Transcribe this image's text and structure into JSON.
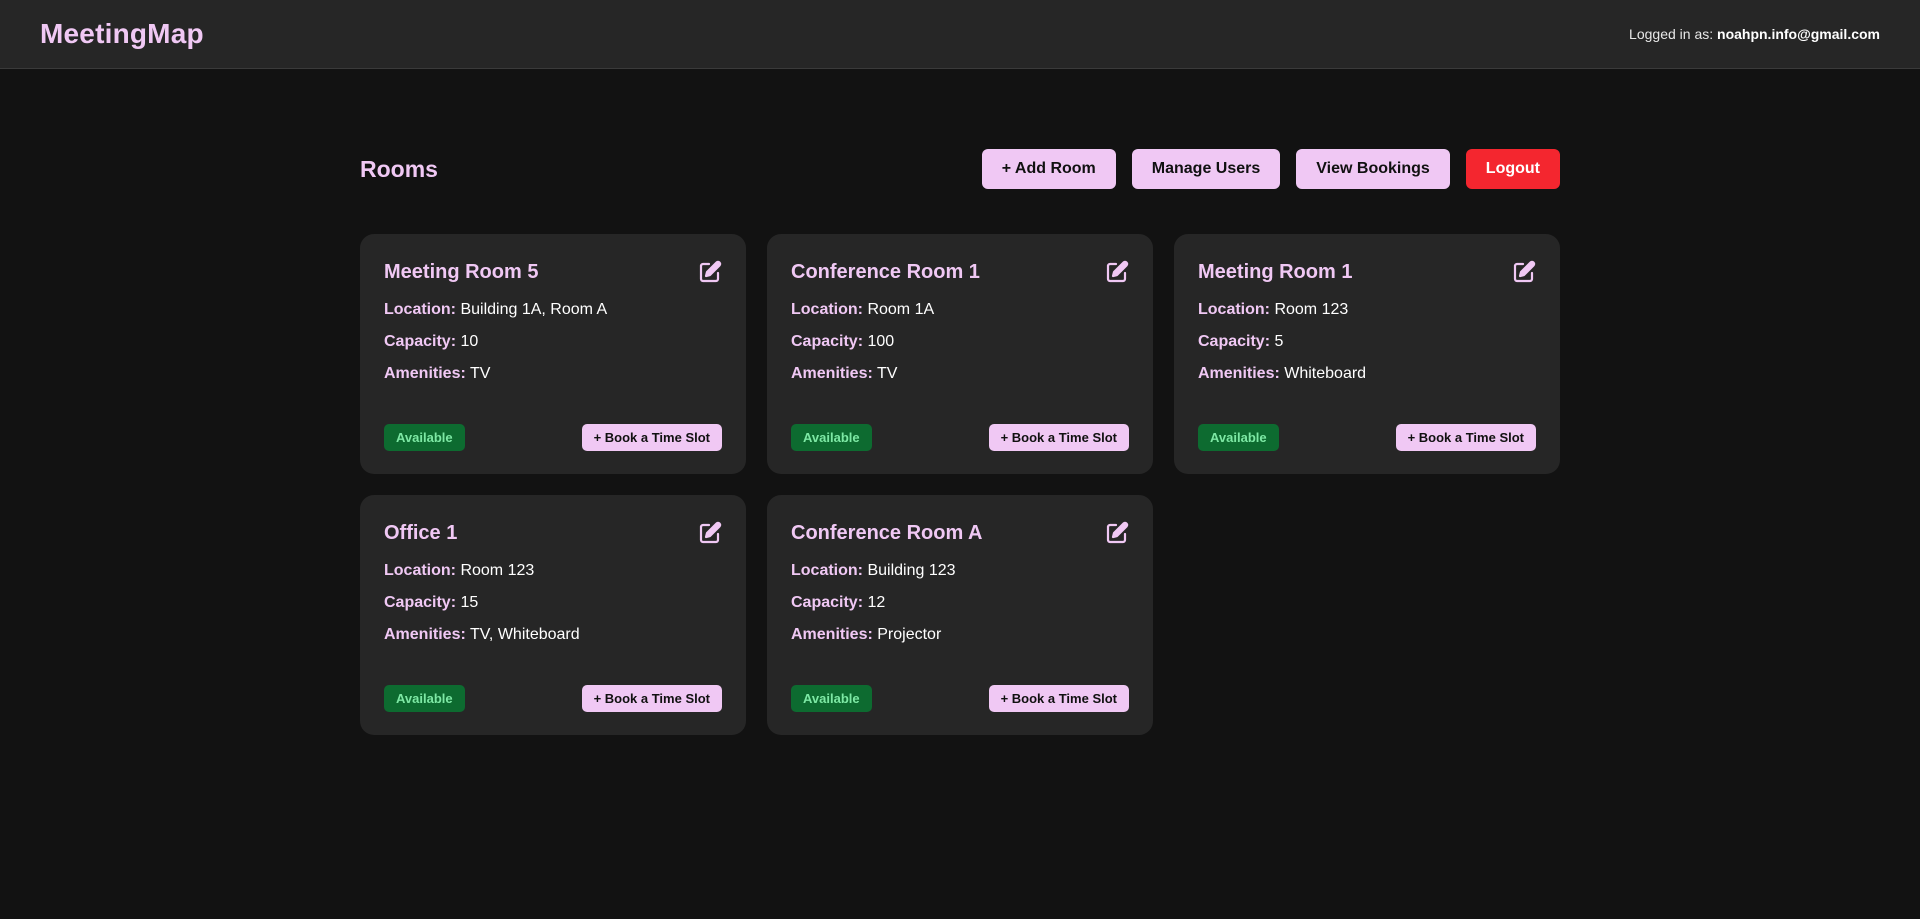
{
  "app": {
    "brand": "MeetingMap",
    "logged_in_label": "Logged in as:",
    "user_email": "noahpn.info@gmail.com"
  },
  "page": {
    "title": "Rooms",
    "actions": {
      "add_room": "+ Add Room",
      "manage_users": "Manage Users",
      "view_bookings": "View Bookings",
      "logout": "Logout"
    }
  },
  "labels": {
    "location": "Location:",
    "capacity": "Capacity:",
    "amenities": "Amenities:"
  },
  "rooms": [
    {
      "name": "Meeting Room 5",
      "location": "Building 1A, Room A",
      "capacity": "10",
      "amenities": "TV",
      "status": "Available",
      "book_label": "+ Book a Time Slot"
    },
    {
      "name": "Conference Room 1",
      "location": "Room 1A",
      "capacity": "100",
      "amenities": "TV",
      "status": "Available",
      "book_label": "+ Book a Time Slot"
    },
    {
      "name": "Meeting Room 1",
      "location": "Room 123",
      "capacity": "5",
      "amenities": "Whiteboard",
      "status": "Available",
      "book_label": "+ Book a Time Slot"
    },
    {
      "name": "Office 1",
      "location": "Room 123",
      "capacity": "15",
      "amenities": "TV, Whiteboard",
      "status": "Available",
      "book_label": "+ Book a Time Slot"
    },
    {
      "name": "Conference Room A",
      "location": "Building 123",
      "capacity": "12",
      "amenities": "Projector",
      "status": "Available",
      "book_label": "+ Book a Time Slot"
    }
  ],
  "icons": {
    "edit": "edit-icon"
  },
  "colors": {
    "accent": "#f0c8f4",
    "danger": "#f4262f",
    "available_bg": "#0d6b30",
    "available_text": "#7de8a4",
    "card_bg": "#262626",
    "page_bg": "#121212"
  }
}
